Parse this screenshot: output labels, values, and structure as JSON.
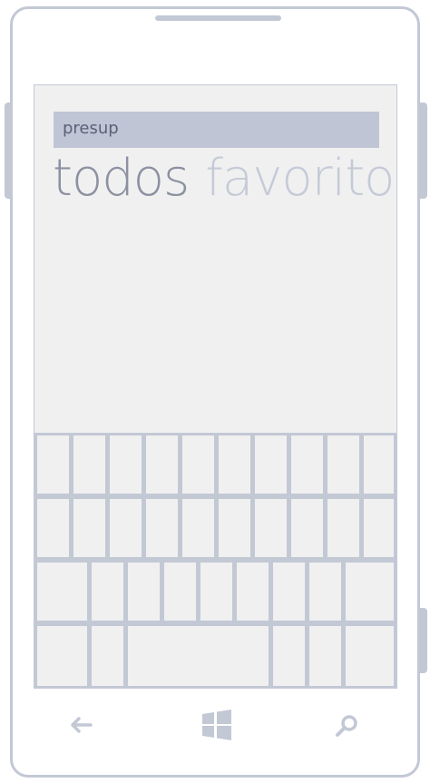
{
  "search": {
    "value": "presup"
  },
  "pivot": {
    "active_label": "todos",
    "next_label": "favoritos"
  },
  "navbar": {
    "back_icon": "back-arrow-icon",
    "start_icon": "windows-logo-icon",
    "search_icon": "search-icon"
  },
  "colors": {
    "frame": "#c3c8d5",
    "screen": "#f0f0f0",
    "search_box": "#bfc5d4",
    "pivot_active": "#8c91a1",
    "pivot_inactive": "#c5cad7"
  }
}
